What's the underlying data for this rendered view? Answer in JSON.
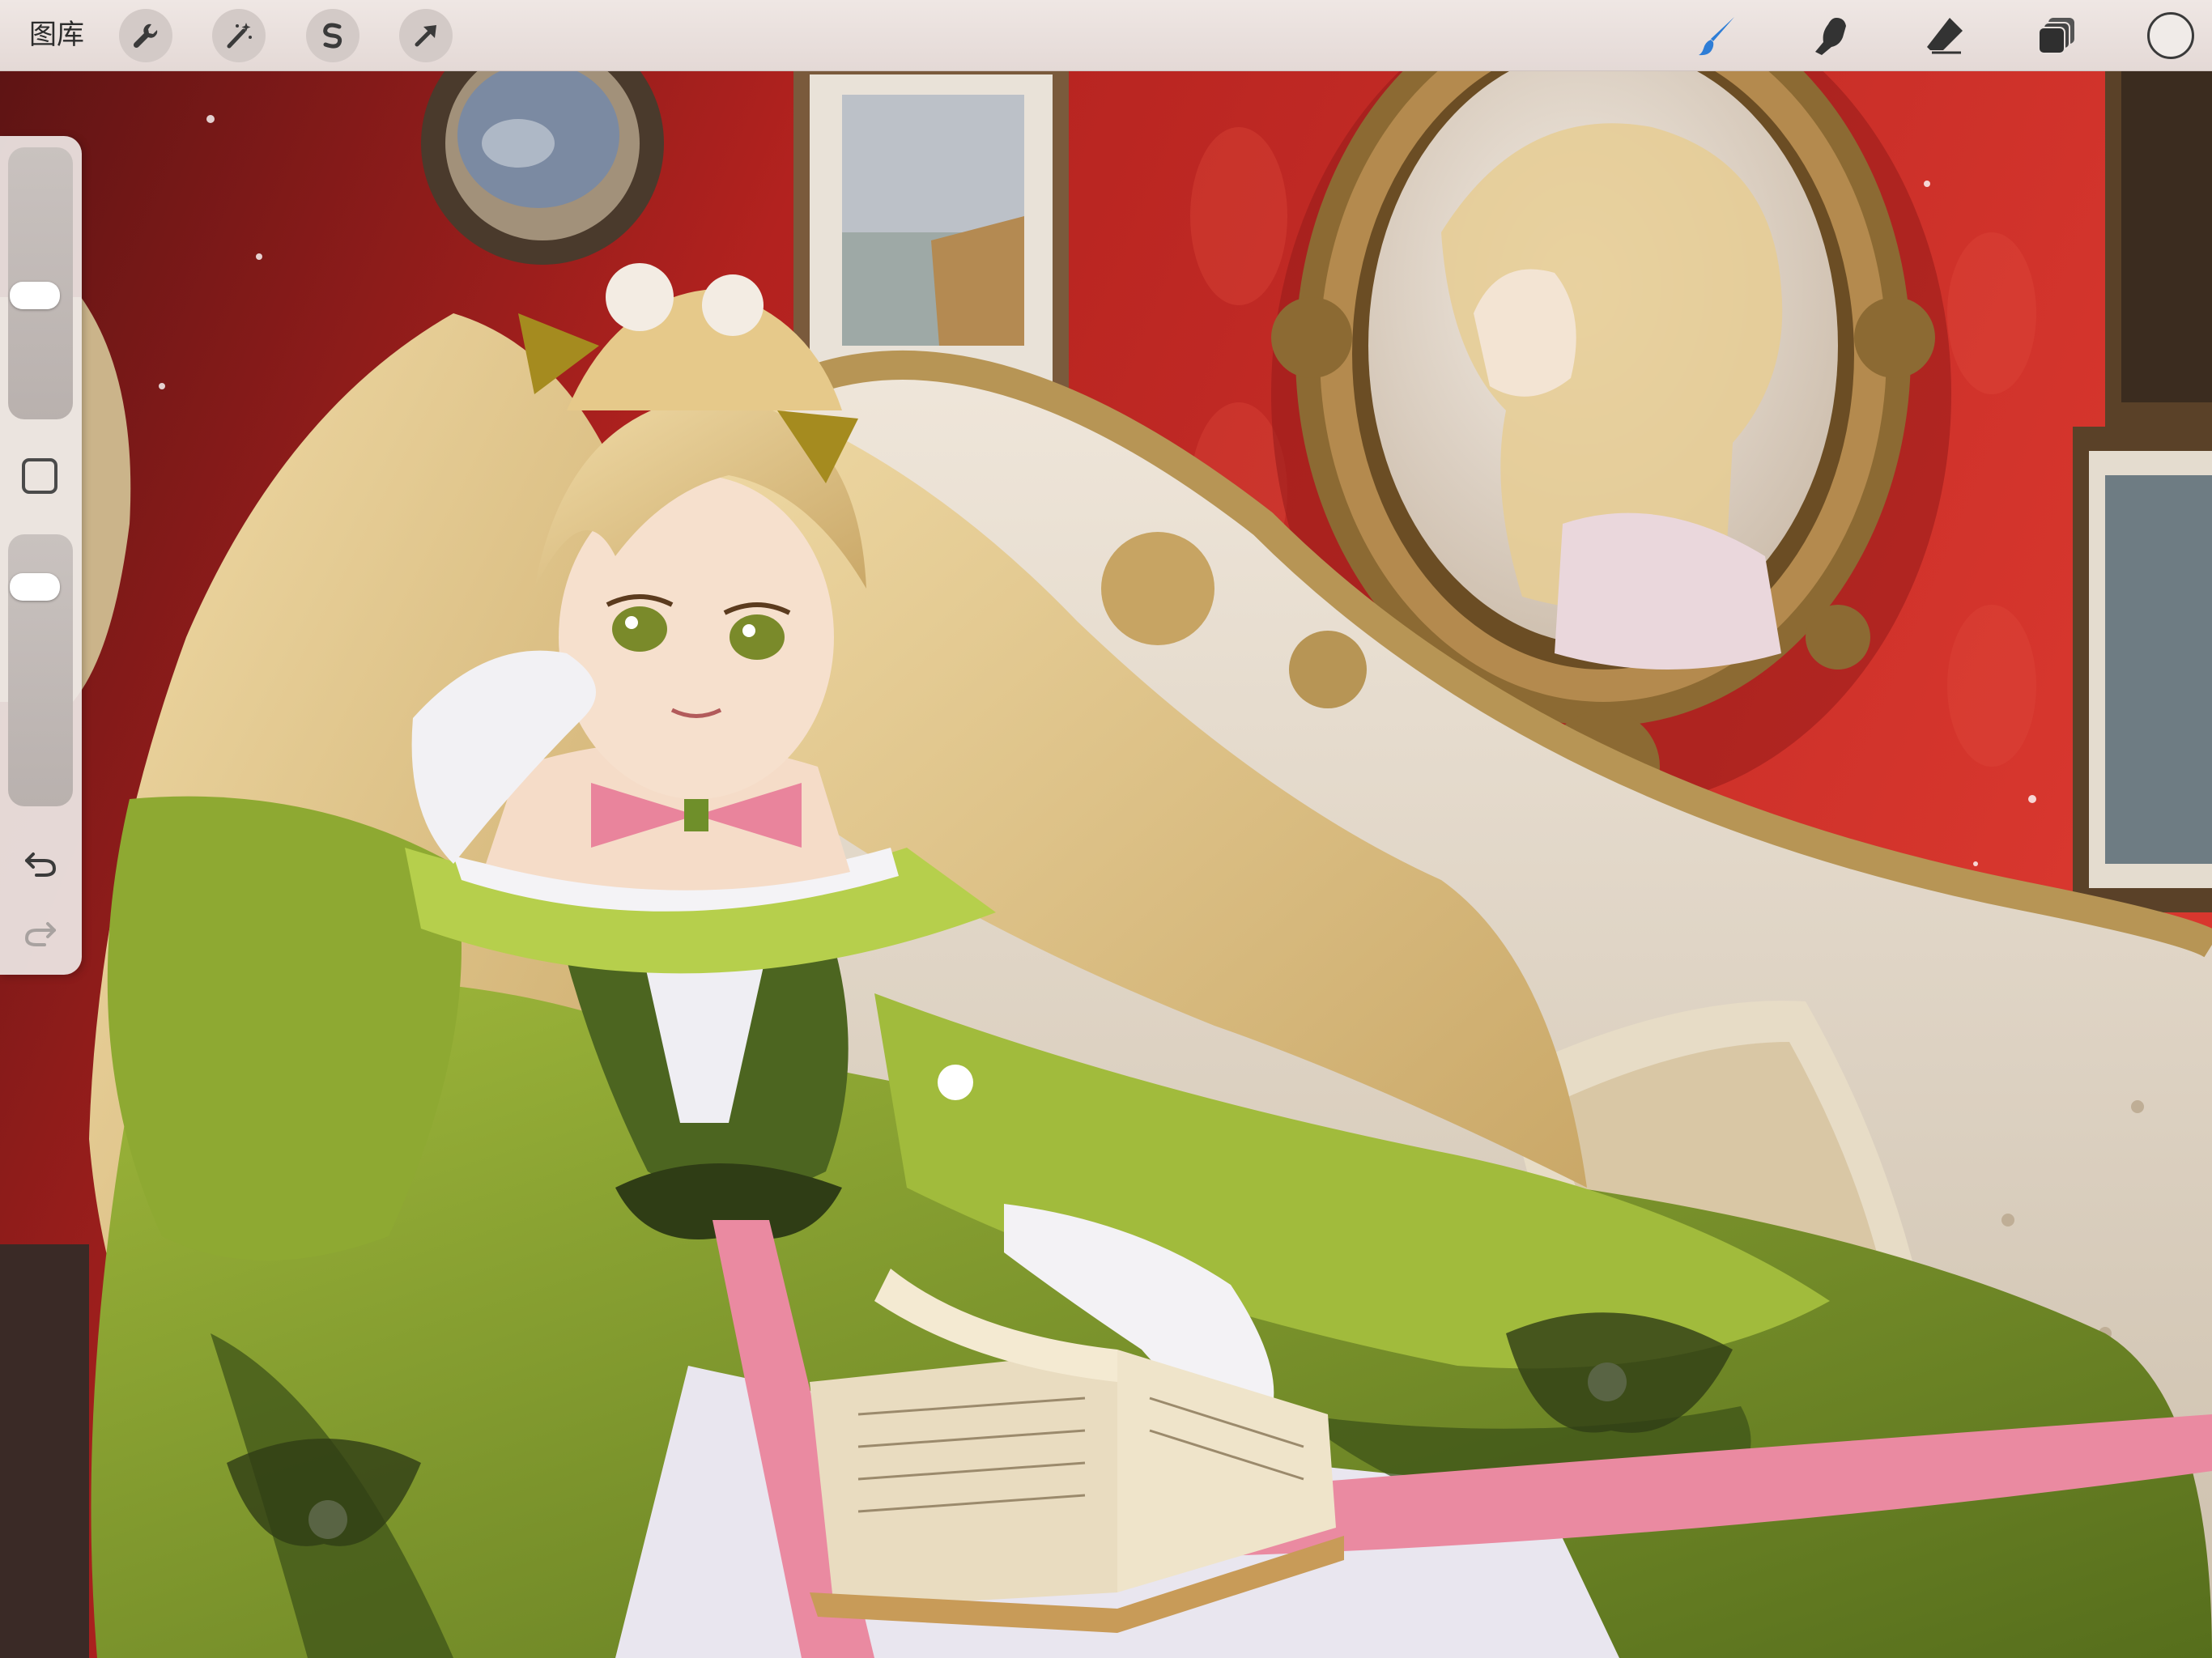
{
  "topbar": {
    "gallery_label": "图库",
    "left_tools": [
      {
        "name": "actions",
        "icon": "wrench-icon"
      },
      {
        "name": "adjustments",
        "icon": "magic-wand-icon"
      },
      {
        "name": "selection",
        "icon": "selection-s-icon"
      },
      {
        "name": "transform",
        "icon": "arrow-cursor-icon"
      }
    ],
    "right_tools": [
      {
        "name": "paint",
        "icon": "brush-icon",
        "active": true
      },
      {
        "name": "smudge",
        "icon": "smudge-finger-icon"
      },
      {
        "name": "erase",
        "icon": "eraser-icon"
      },
      {
        "name": "layers",
        "icon": "layers-icon"
      }
    ],
    "current_color": "#f0ebe8"
  },
  "sidebar": {
    "brush_size": 0.45,
    "brush_opacity": 0.85,
    "icons": [
      "modify-square-icon",
      "undo-icon",
      "redo-icon"
    ]
  },
  "colors": {
    "accent": "#2e7dd6",
    "wall": "#c42a26",
    "dress": "#7c9a2a",
    "hair": "#e9cf95",
    "ribbon": "#ea8aa1",
    "frame_gold": "#8c6a33"
  }
}
